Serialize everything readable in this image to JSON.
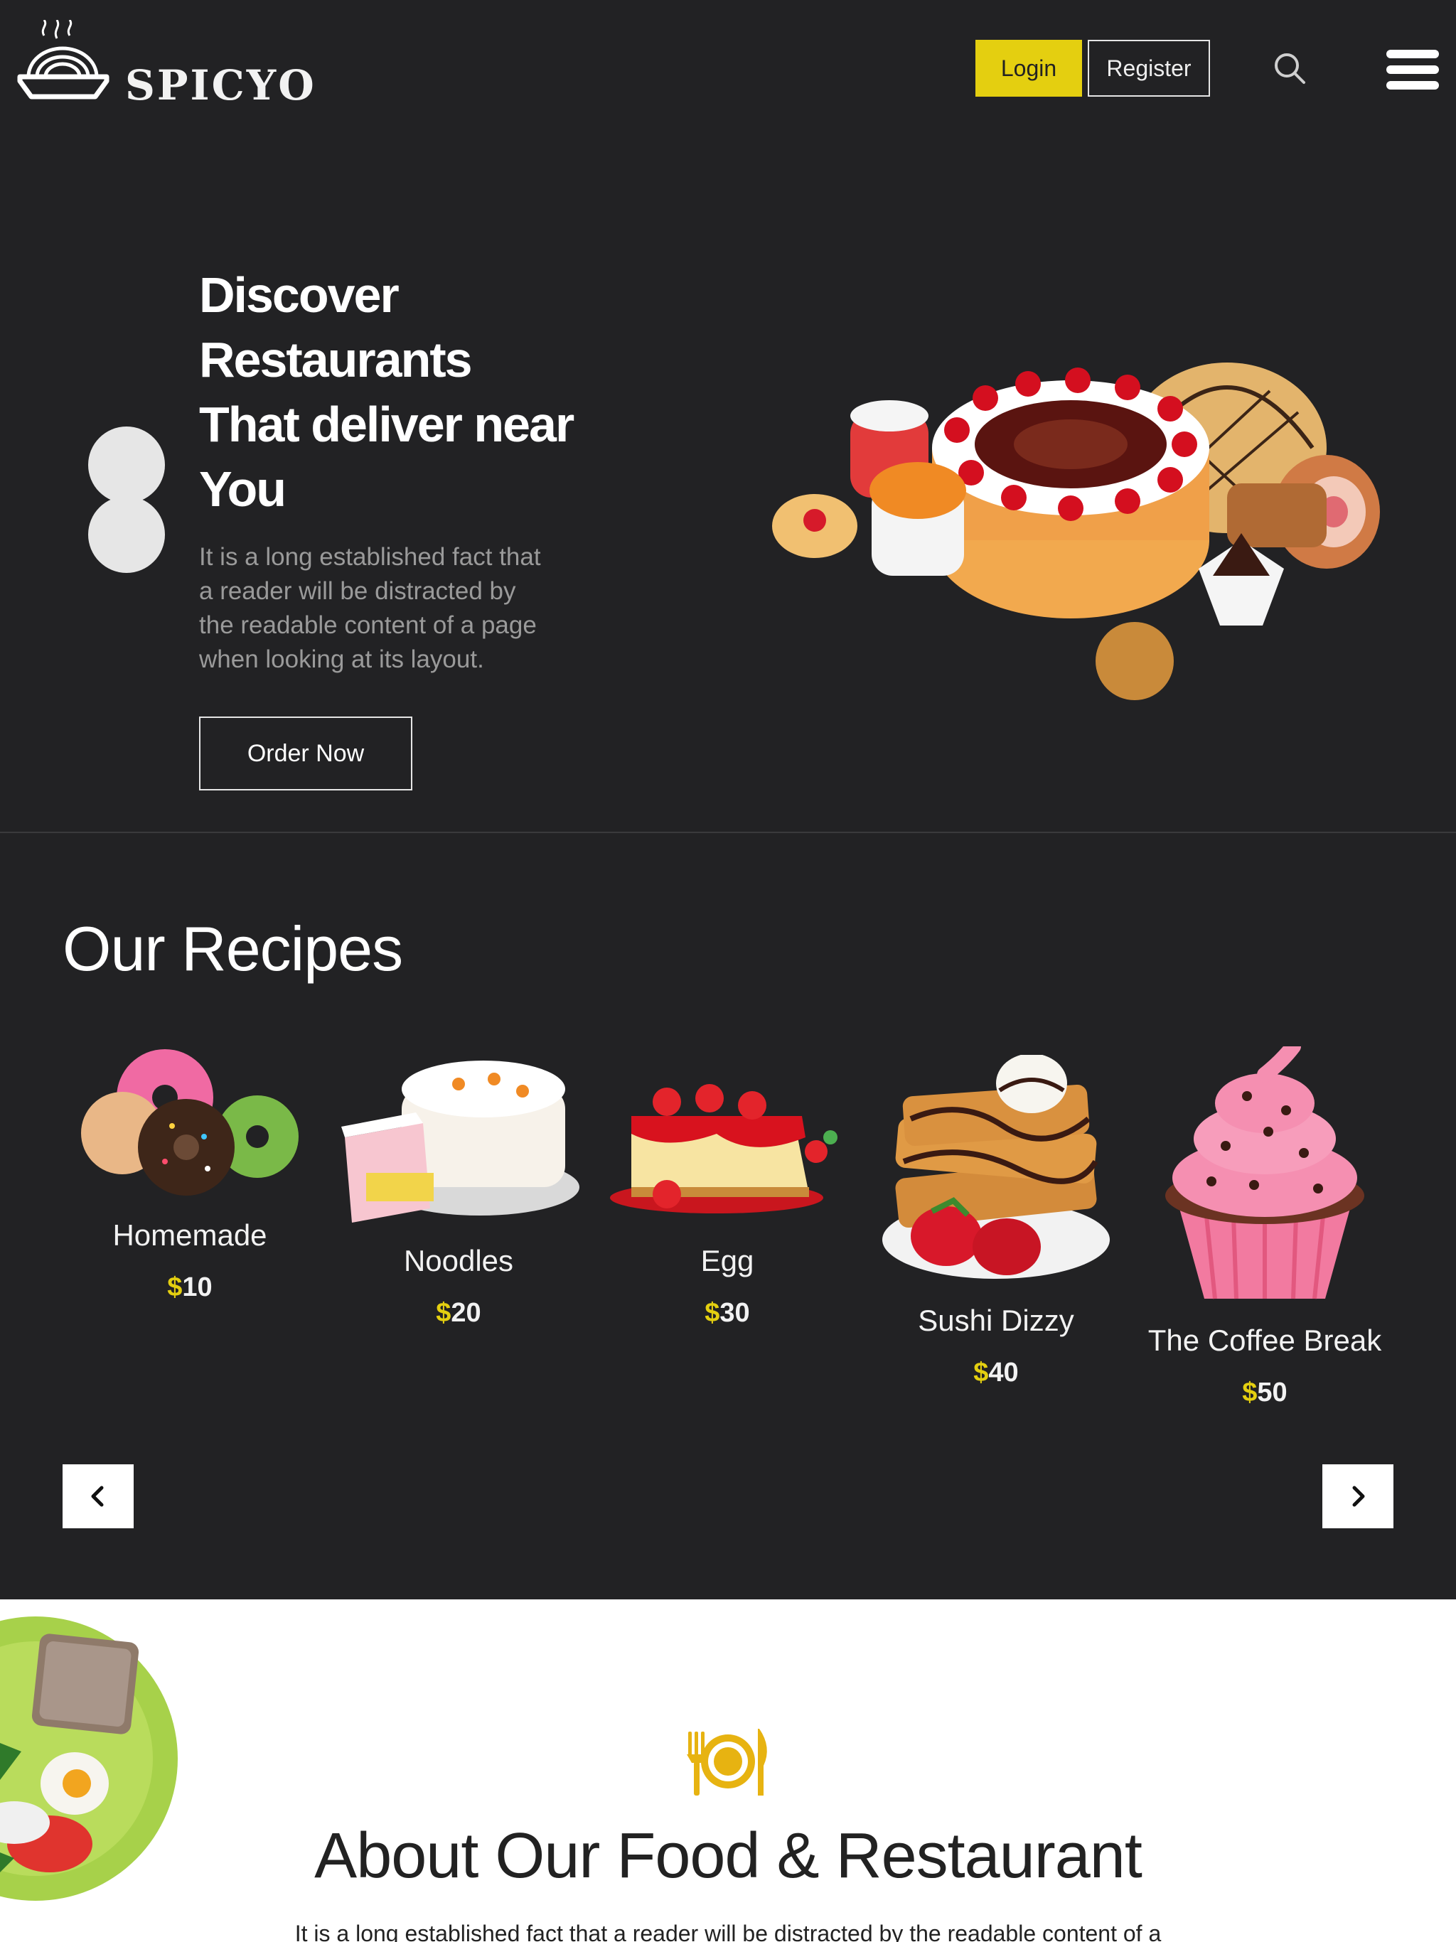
{
  "brand": {
    "name": "SPICYO"
  },
  "header": {
    "login_label": "Login",
    "register_label": "Register",
    "search_icon": "search-icon",
    "menu_icon": "hamburger-menu-icon"
  },
  "hero": {
    "title_lines": [
      "Discover",
      "Restaurants",
      "That deliver near",
      "You"
    ],
    "description": "It is a long established fact that a reader will be distracted by the readable content of a page when looking at its layout.",
    "order_label": "Order Now"
  },
  "recipes": {
    "title": "Our Recipes",
    "items": [
      {
        "name": "Homemade",
        "currency": "$",
        "amount": "10"
      },
      {
        "name": "Noodles",
        "currency": "$",
        "amount": "20"
      },
      {
        "name": "Egg",
        "currency": "$",
        "amount": "30"
      },
      {
        "name": "Sushi Dizzy",
        "currency": "$",
        "amount": "40"
      },
      {
        "name": "The Coffee Break",
        "currency": "$",
        "amount": "50"
      }
    ],
    "prev_icon": "chevron-left-icon",
    "next_icon": "chevron-right-icon"
  },
  "about": {
    "icon": "plate-cutlery-icon",
    "title": "About Our Food & Restaurant",
    "text": "It is a long established fact that a reader will be distracted by the readable content of a"
  },
  "colors": {
    "background": "#222224",
    "accent": "#e4cf10",
    "about_background": "#ffffff",
    "text_dark": "#222222"
  }
}
